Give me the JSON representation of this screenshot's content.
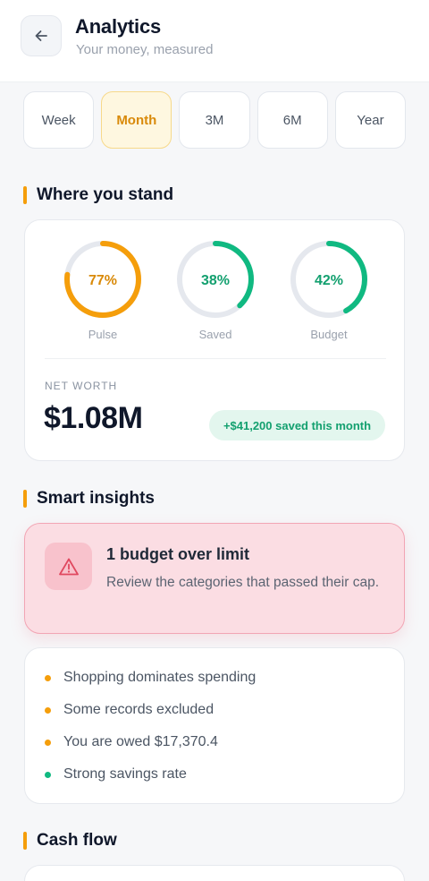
{
  "header": {
    "title": "Analytics",
    "subtitle": "Your money, measured"
  },
  "tabs": [
    {
      "label": "Week",
      "active": false
    },
    {
      "label": "Month",
      "active": true
    },
    {
      "label": "3M",
      "active": false
    },
    {
      "label": "6M",
      "active": false
    },
    {
      "label": "Year",
      "active": false
    }
  ],
  "standing": {
    "title": "Where you stand",
    "rings": [
      {
        "label": "Pulse",
        "value_text": "77%",
        "value": 77,
        "color": "#f59e0b"
      },
      {
        "label": "Saved",
        "value_text": "38%",
        "value": 38,
        "color": "#10b981"
      },
      {
        "label": "Budget",
        "value_text": "42%",
        "value": 42,
        "color": "#10b981"
      }
    ],
    "ring_track_color": "#e5e8ee",
    "net_worth_label": "NET WORTH",
    "net_worth_value": "$1.08M",
    "saved_chip": "+$41,200 saved this month"
  },
  "insights": {
    "title": "Smart insights",
    "alert": {
      "title": "1 budget over limit",
      "body": "Review the categories that passed their cap.",
      "icon": "warning-triangle-icon"
    },
    "items": [
      {
        "text": "Shopping dominates spending",
        "color": "#f59e0b"
      },
      {
        "text": "Some records excluded",
        "color": "#f59e0b"
      },
      {
        "text": "You are owed $17,370.4",
        "color": "#f59e0b"
      },
      {
        "text": "Strong savings rate",
        "color": "#10b981"
      }
    ]
  },
  "cashflow": {
    "title": "Cash flow"
  }
}
